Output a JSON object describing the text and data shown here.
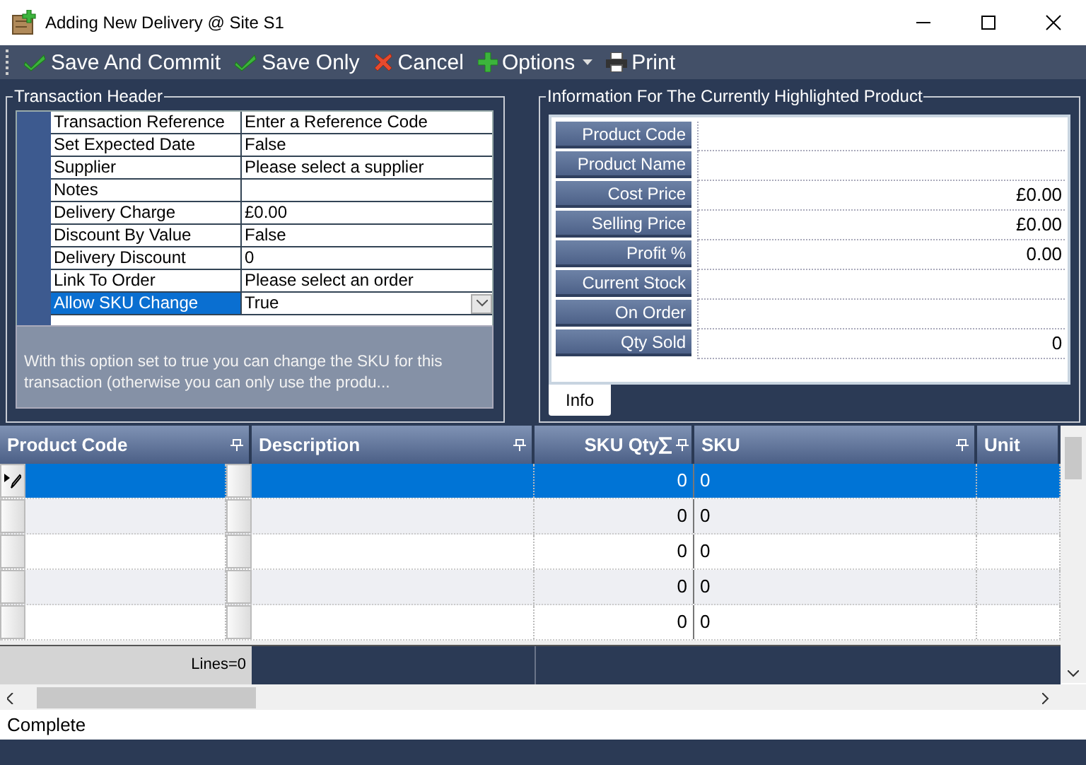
{
  "window": {
    "title": "Adding New Delivery @ Site S1"
  },
  "toolbar": [
    {
      "kind": "save",
      "label": "Save And Commit"
    },
    {
      "kind": "save",
      "label": "Save Only"
    },
    {
      "kind": "cancel",
      "label": "Cancel"
    },
    {
      "kind": "options",
      "label": "Options"
    },
    {
      "kind": "print",
      "label": "Print"
    }
  ],
  "transaction_header": {
    "title": "Transaction Header",
    "properties": [
      {
        "name": "Transaction Reference",
        "value": "Enter a Reference Code",
        "selected": false
      },
      {
        "name": "Set Expected Date",
        "value": "False",
        "selected": false
      },
      {
        "name": "Supplier",
        "value": "Please select a supplier",
        "selected": false
      },
      {
        "name": "Notes",
        "selected": false
      },
      {
        "name": "Delivery Charge",
        "value": "£0.00",
        "selected": false
      },
      {
        "name": "Discount By Value",
        "value": "False",
        "selected": false
      },
      {
        "name": "Delivery Discount",
        "value": "0",
        "selected": false
      },
      {
        "name": "Link To Order",
        "value": "Please select an order",
        "selected": false
      },
      {
        "name": "Allow SKU Change",
        "value": "True",
        "selected": true
      }
    ],
    "description": "With this option set to true you can change the SKU for this transaction (otherwise you can only use the produ..."
  },
  "product_info": {
    "title": "Information For The Currently Highlighted Product",
    "fields": [
      {
        "label": "Product Code"
      },
      {
        "label": "Product Name"
      },
      {
        "label": "Cost Price",
        "value": "£0.00"
      },
      {
        "label": "Selling Price",
        "value": "£0.00"
      },
      {
        "label": "Profit %",
        "value": "0.00"
      },
      {
        "label": "Current Stock"
      },
      {
        "label": "On Order"
      },
      {
        "label": "Qty Sold",
        "value": "0"
      }
    ],
    "tabs": [
      {
        "label": "Info",
        "selected": true
      }
    ]
  },
  "grid": {
    "columns": [
      {
        "label": "Product Code",
        "summed": false
      },
      {
        "label": "Description",
        "summed": false
      },
      {
        "label": "SKU Qty",
        "summed": true
      },
      {
        "label": "SKU",
        "summed": false
      },
      {
        "label": "Unit",
        "summed": false
      }
    ],
    "rows": [
      {
        "selected": true,
        "sku_qty": "0",
        "sku": "0"
      },
      {
        "selected": false,
        "sku_qty": "0",
        "sku": "0"
      },
      {
        "selected": false,
        "sku_qty": "0",
        "sku": "0"
      },
      {
        "selected": false,
        "sku_qty": "0",
        "sku": "0"
      },
      {
        "selected": false,
        "sku_qty": "0",
        "sku": "0"
      }
    ],
    "footer": "Lines=0"
  },
  "status_bar": {
    "text": "Complete"
  }
}
